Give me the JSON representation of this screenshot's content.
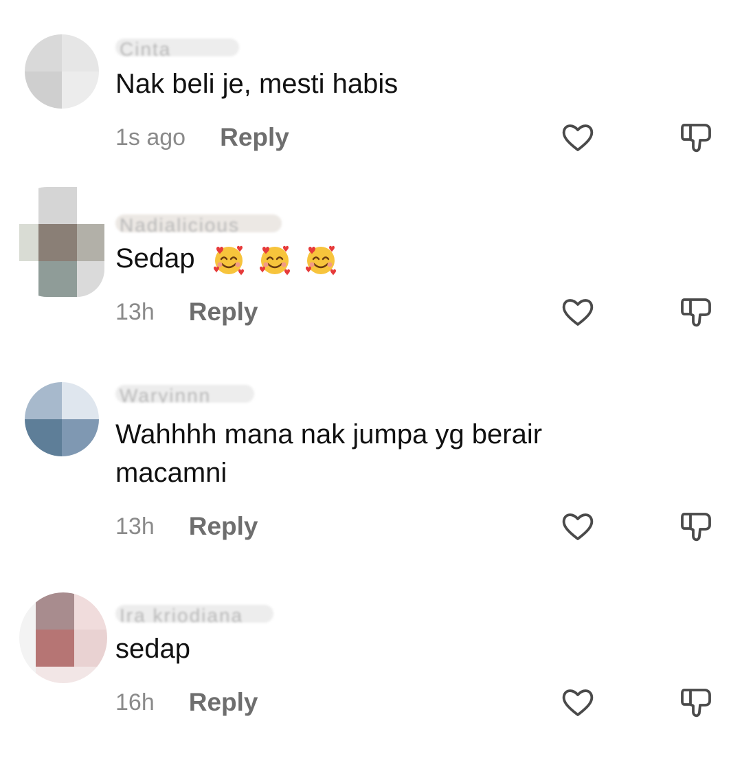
{
  "comments": [
    {
      "username": "Cinta",
      "text": "Nak beli je, mesti habis",
      "time": "1s ago",
      "reply_label": "Reply",
      "emoji_count": 0,
      "avatar_colors": [
        "#d9d9d9",
        "#e6e6e6",
        "#cfcfcf",
        "#ececec"
      ]
    },
    {
      "username": "Nadialicious",
      "text": "Sedap",
      "time": "13h",
      "reply_label": "Reply",
      "emoji_count": 3,
      "avatar_colors": [
        "#d5d5d5",
        "#8a7f76",
        "#8f9c98",
        "#c9c9c9"
      ]
    },
    {
      "username": "Waryinnn",
      "text": "Wahhhh mana nak jumpa yg berair macamni",
      "time": "13h",
      "reply_label": "Reply",
      "emoji_count": 0,
      "avatar_colors": [
        "#a7b9cc",
        "#5e7e98",
        "#7f98b2",
        "#dfe6ee"
      ]
    },
    {
      "username": "Ira kriodiana",
      "text": "sedap",
      "time": "16h",
      "reply_label": "Reply",
      "emoji_count": 0,
      "avatar_colors": [
        "#a88c8e",
        "#b67574",
        "#f0dcdc",
        "#e9d2d2"
      ]
    }
  ],
  "icons": {
    "like": "heart-outline-icon",
    "dislike": "thumbs-down-outline-icon",
    "emoji": "smiling-face-with-hearts-emoji"
  },
  "colors": {
    "text": "#111111",
    "meta": "#8a8a8a",
    "reply": "#6e6e6e",
    "icon": "#4a4a4a"
  }
}
